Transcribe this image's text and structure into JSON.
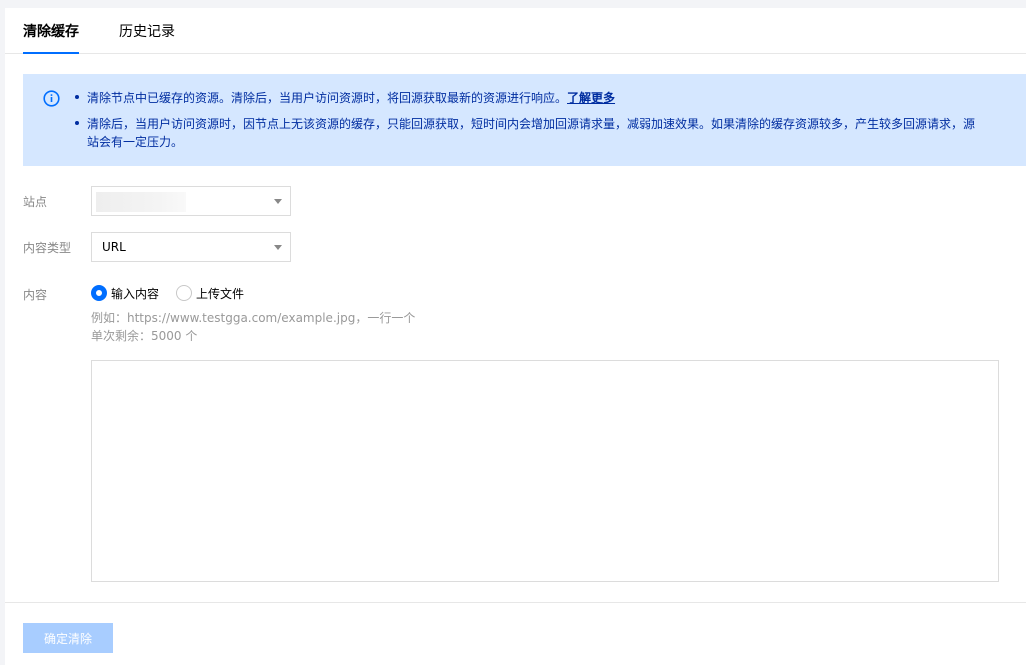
{
  "tabs": [
    {
      "label": "清除缓存",
      "active": true
    },
    {
      "label": "历史记录",
      "active": false
    }
  ],
  "notice": {
    "icon": "info-icon",
    "line1": "清除节点中已缓存的资源。清除后，当用户访问资源时，将回源获取最新的资源进行响应。",
    "learn_more": "了解更多",
    "line2": "清除后，当用户访问资源时，因节点上无该资源的缓存，只能回源获取，短时间内会增加回源请求量，减弱加速效果。如果清除的缓存资源较多，产生较多回源请求，源",
    "line2_cont": "站会有一定压力。"
  },
  "form": {
    "site_label": "站点",
    "site_value": "",
    "type_label": "内容类型",
    "type_value": "URL",
    "content_label": "内容",
    "radio_input": "输入内容",
    "radio_upload": "上传文件",
    "hint_example": "例如：https://www.testgga.com/example.jpg，一行一个",
    "hint_remaining": "单次剩余：5000 个",
    "textarea_value": ""
  },
  "submit_label": "确定清除",
  "colors": {
    "primary": "#006eff",
    "notice_bg": "#d5e7ff",
    "notice_text": "#002da0",
    "disabled_button": "#a8cdff"
  }
}
